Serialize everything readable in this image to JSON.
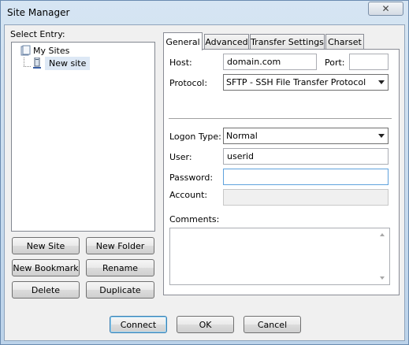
{
  "window": {
    "title": "Site Manager"
  },
  "left": {
    "select_entry_label": "Select Entry:",
    "tree": [
      {
        "label": "My Sites",
        "icon": "folder-icon"
      },
      {
        "label": "New site",
        "icon": "computer-icon",
        "selected": true
      }
    ],
    "buttons": {
      "new_site": "New Site",
      "new_folder": "New Folder",
      "new_bookmark": "New Bookmark",
      "rename": "Rename",
      "delete": "Delete",
      "duplicate": "Duplicate"
    }
  },
  "tabs": [
    {
      "label": "General",
      "active": true
    },
    {
      "label": "Advanced"
    },
    {
      "label": "Transfer Settings"
    },
    {
      "label": "Charset"
    }
  ],
  "general": {
    "host_label": "Host:",
    "host_value": "domain.com",
    "port_label": "Port:",
    "port_value": "",
    "protocol_label": "Protocol:",
    "protocol_value": "SFTP - SSH File Transfer Protocol",
    "logon_type_label": "Logon Type:",
    "logon_type_value": "Normal",
    "user_label": "User:",
    "user_value": "userid",
    "password_label": "Password:",
    "password_value": "",
    "account_label": "Account:",
    "account_value": "",
    "comments_label": "Comments:",
    "comments_value": ""
  },
  "footer": {
    "connect": "Connect",
    "ok": "OK",
    "cancel": "Cancel"
  }
}
